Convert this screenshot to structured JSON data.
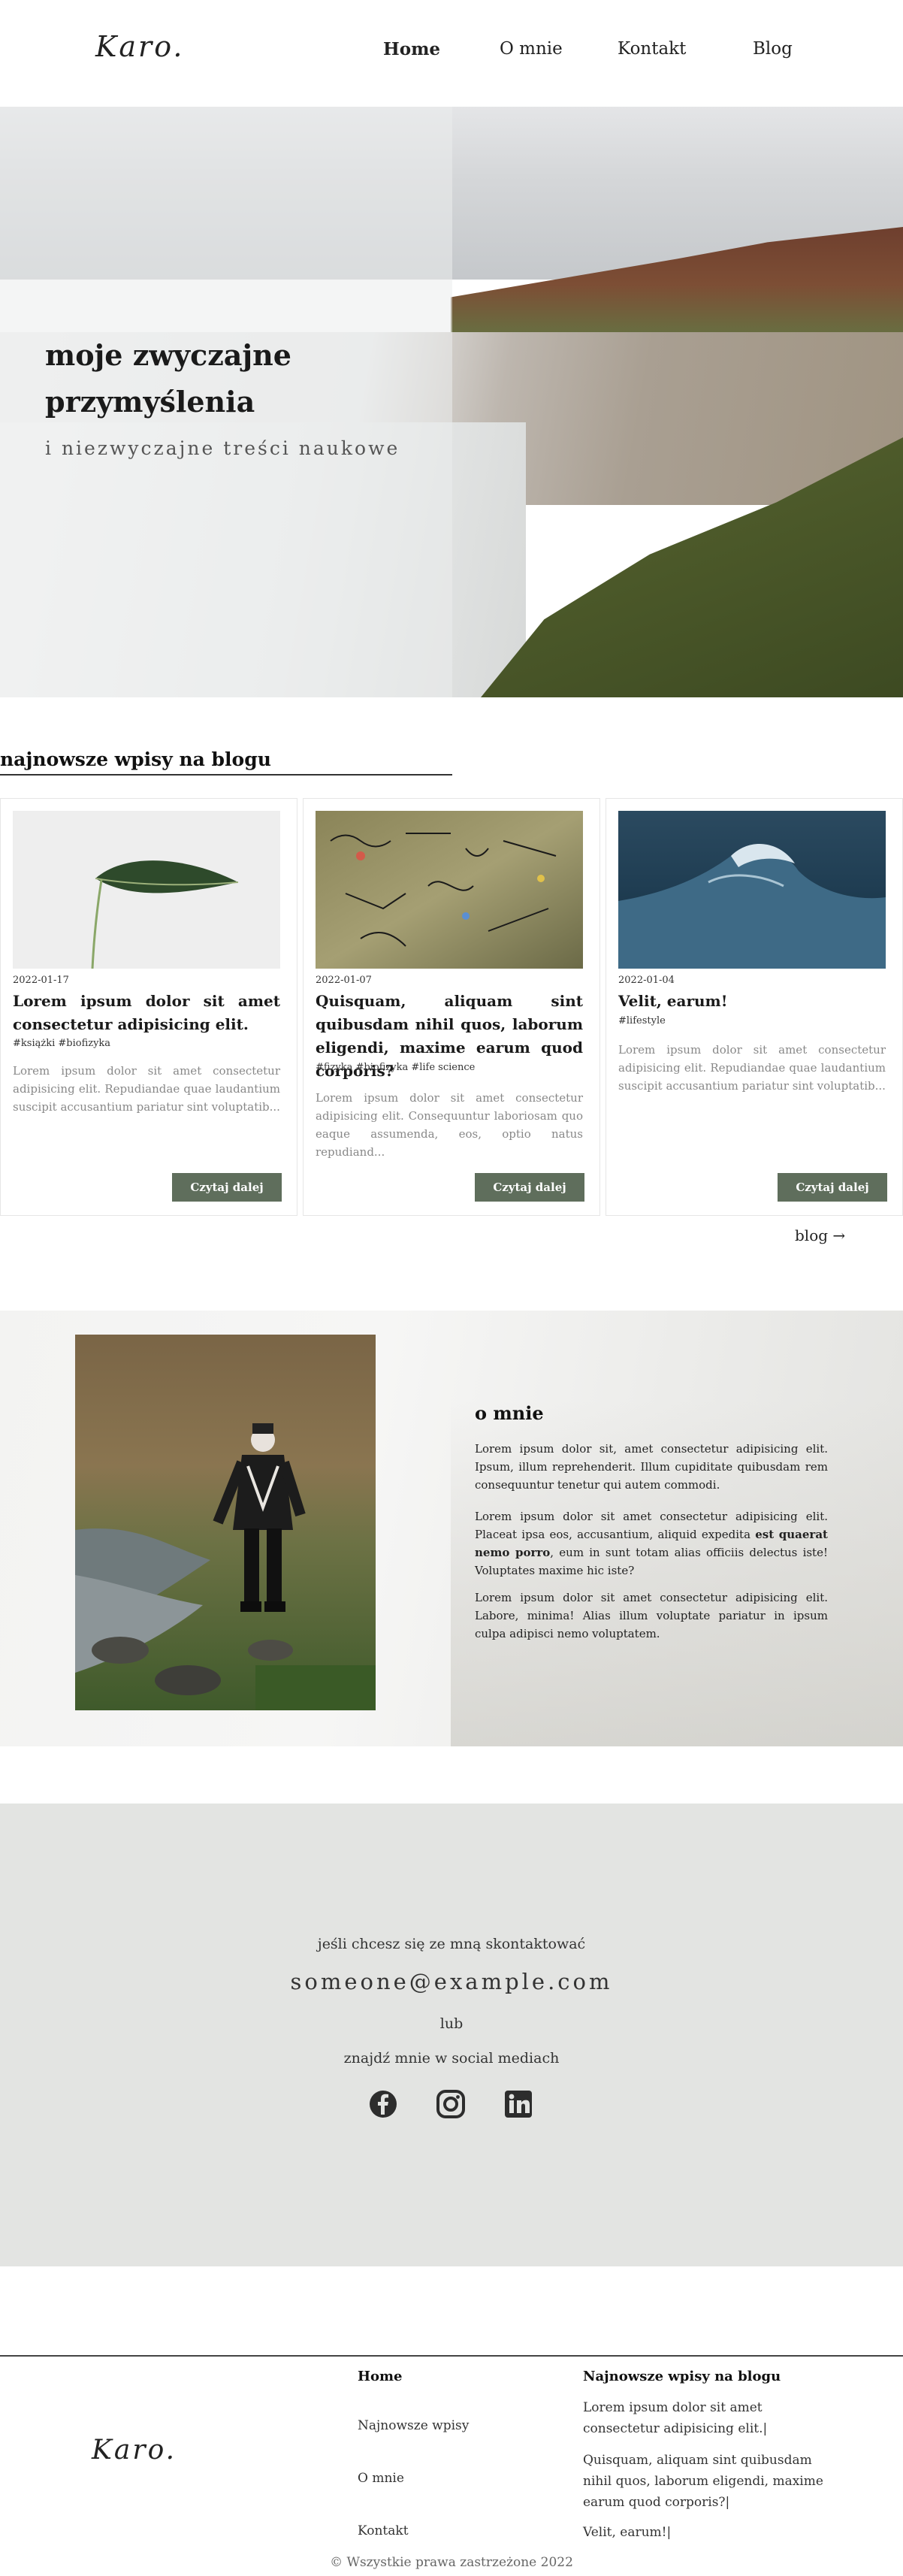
{
  "header": {
    "logo": "Karo.",
    "nav": [
      {
        "label": "Home",
        "active": true
      },
      {
        "label": "O mnie",
        "active": false
      },
      {
        "label": "Kontakt",
        "active": false
      },
      {
        "label": "Blog",
        "active": false
      }
    ]
  },
  "hero": {
    "title": "moje zwyczajne przymyślenia",
    "subtitle": "i niezwyczajne treści naukowe"
  },
  "blog": {
    "heading": "najnowsze wpisy na blogu",
    "more_link": "blog →",
    "posts": [
      {
        "date": "2022-01-17",
        "title": "Lorem ipsum dolor sit amet consectetur adipisicing elit.",
        "tags": "#książki #biofizyka",
        "excerpt": "Lorem ipsum dolor sit amet consectetur adipisicing elit. Repudiandae quae laudantium suscipit accusantium pariatur sint voluptatib...",
        "button": "Czytaj dalej",
        "image": "leaf-photo"
      },
      {
        "date": "2022-01-07",
        "title": "Quisquam, aliquam sint quibusdam nihil quos, laborum eligendi, maxime earum quod corporis?",
        "tags": "#fizyka #biofizyka #life science",
        "excerpt": "Lorem ipsum dolor sit amet consectetur adipisicing elit. Consequuntur laboriosam quo eaque assumenda, eos, optio natus repudiand...",
        "button": "Czytaj dalej",
        "image": "formulas-photo"
      },
      {
        "date": "2022-01-04",
        "title": "Velit, earum!",
        "tags": "#lifestyle",
        "excerpt": "Lorem ipsum dolor sit amet consectetur adipisicing elit. Repudiandae quae laudantium suscipit accusantium pariatur sint voluptatib...",
        "button": "Czytaj dalej",
        "image": "wave-photo"
      }
    ]
  },
  "about": {
    "title": "o mnie",
    "p1": "Lorem ipsum dolor sit, amet consectetur adipisicing elit. Ipsum, illum reprehenderit. Illum cupiditate quibusdam rem consequuntur tenetur qui autem commodi.",
    "p2_before": "Lorem ipsum dolor sit amet consectetur adipisicing elit. Placeat ipsa eos, accusantium, aliquid expedita ",
    "p2_bold": "est quaerat nemo porro",
    "p2_after": ", eum in sunt totam alias officiis delectus iste! Voluptates maxime hic iste?",
    "p3": "Lorem ipsum dolor sit amet consectetur adipisicing elit. Labore, minima! Alias illum voluptate pariatur in ipsum culpa adipisci nemo voluptatem."
  },
  "contact": {
    "intro": "jeśli chcesz się ze mną skontaktować",
    "email": "someone@example.com",
    "or": "lub",
    "social_intro": "znajdź mnie w social mediach",
    "socials": [
      "facebook-icon",
      "instagram-icon",
      "linkedin-icon"
    ]
  },
  "footer": {
    "logo": "Karo.",
    "col1_title": "Home",
    "links": [
      "Najnowsze wpisy",
      "O mnie",
      "Kontakt"
    ],
    "col2_title": "Najnowsze wpisy na blogu",
    "posts": [
      "Lorem ipsum dolor sit amet consectetur adipisicing elit.|",
      "Quisquam, aliquam sint quibusdam nihil quos, laborum eligendi, maxime earum quod corporis?|",
      "Velit, earum!|"
    ],
    "copyright": "© Wszystkie prawa zastrzeżone 2022"
  },
  "colors": {
    "button": "#5f6e5c",
    "contact_bg": "#e3e4e2"
  }
}
